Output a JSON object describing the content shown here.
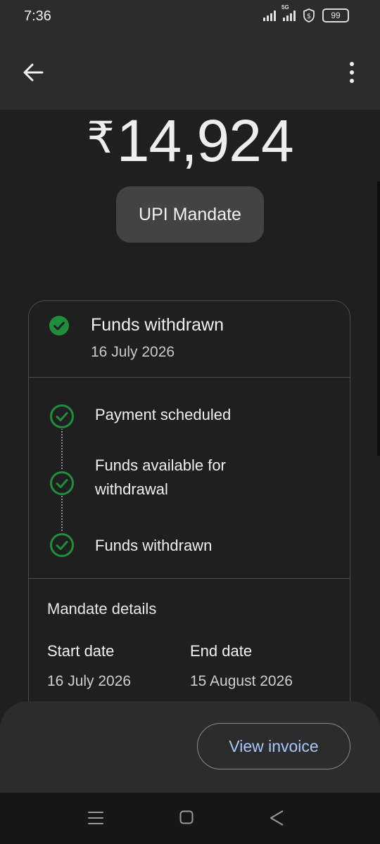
{
  "status_bar": {
    "time": "7:36",
    "network_label": "5G",
    "battery": "99"
  },
  "header": {
    "back_icon": "arrow-left-icon",
    "more_icon": "more-vertical-icon"
  },
  "amount": {
    "currency": "₹",
    "value": "14,924"
  },
  "chip_label": "UPI Mandate",
  "status_card": {
    "title": "Funds withdrawn",
    "date": "16 July 2026",
    "icon": "check-circle-icon",
    "accent": "#1e8e3e"
  },
  "timeline": [
    {
      "label": "Payment scheduled"
    },
    {
      "label": "Funds available for withdrawal"
    },
    {
      "label": "Funds withdrawn"
    }
  ],
  "mandate": {
    "title": "Mandate details",
    "start_label": "Start date",
    "start_value": "16 July 2026",
    "end_label": "End date",
    "end_value": "15 August 2026"
  },
  "actions": {
    "view_invoice": "View invoice",
    "link_color": "#a8c7fa"
  },
  "nav": {
    "menu_icon": "menu-icon",
    "home_icon": "home-square-icon",
    "back_icon": "back-triangle-icon"
  }
}
